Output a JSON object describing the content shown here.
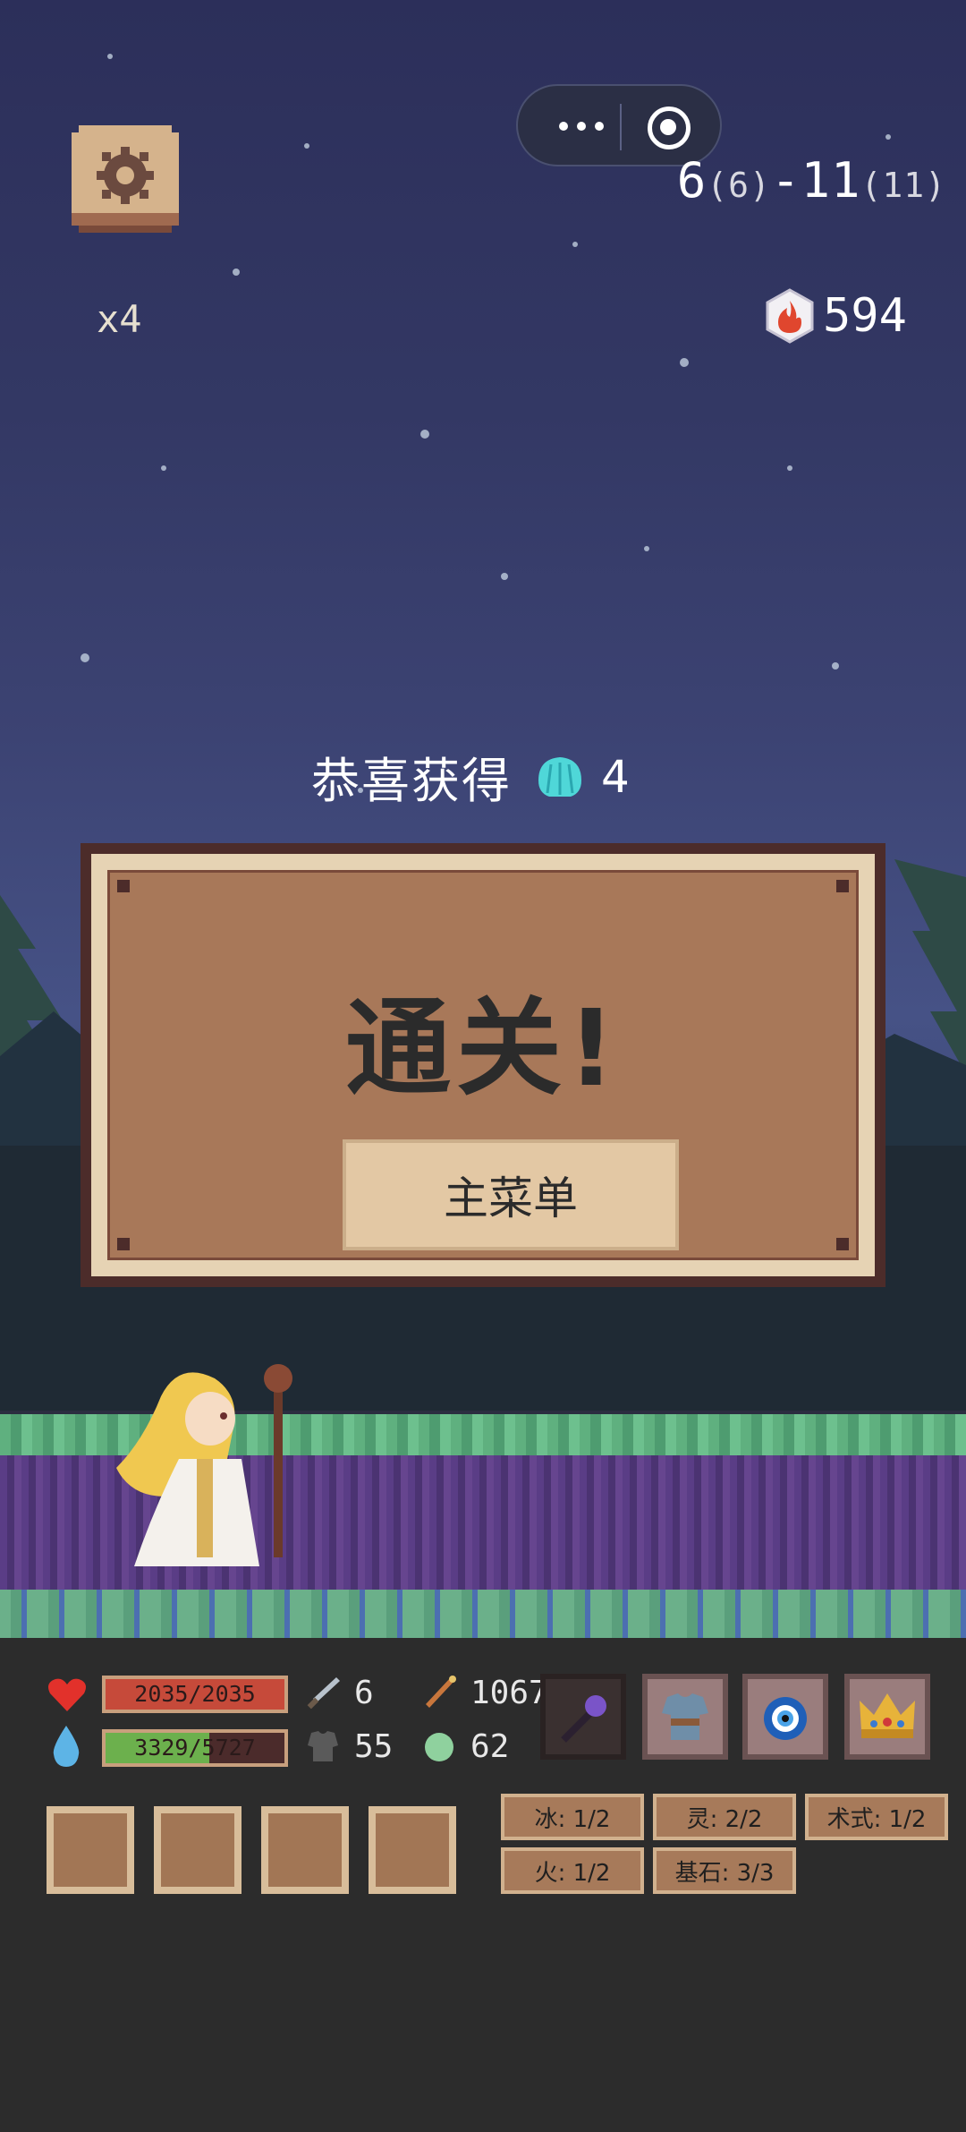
{
  "top_bar": {
    "more_icon": "more-dots-icon",
    "close_icon": "target-close-icon",
    "settings_icon": "gear-icon"
  },
  "status": {
    "level_main": "6",
    "level_main_paren": "(6)",
    "level_sep": "-",
    "level_sub": "11",
    "level_sub_paren": "(11)",
    "speed": "x4",
    "currency_value": "594",
    "currency_icon": "fire-gem-icon"
  },
  "reward": {
    "text": "恭喜获得",
    "icon": "shell-icon",
    "count": "4"
  },
  "dialog": {
    "title": "通关!",
    "menu_button": "主菜单"
  },
  "hud": {
    "hp": "2035/2035",
    "mp": "3329/5727",
    "mp_fill": 0.58,
    "stats": {
      "attack": "6",
      "magic": "1067",
      "defense": "55",
      "spirit": "62"
    },
    "equipment": [
      "staff-icon",
      "armor-icon",
      "amulet-icon",
      "crown-icon"
    ],
    "empty_slots": 4,
    "tags": [
      "冰: 1/2",
      "灵: 2/2",
      "术式: 1/2",
      "火: 1/2",
      "基石: 3/3"
    ]
  },
  "colors": {
    "sky_top": "#2c2f5a",
    "panel_border": "#4c2c2a",
    "panel_fill": "#a87859",
    "button_fill": "#e3c8a4",
    "hp": "#c64a3a",
    "mp": "#6cb04d"
  }
}
